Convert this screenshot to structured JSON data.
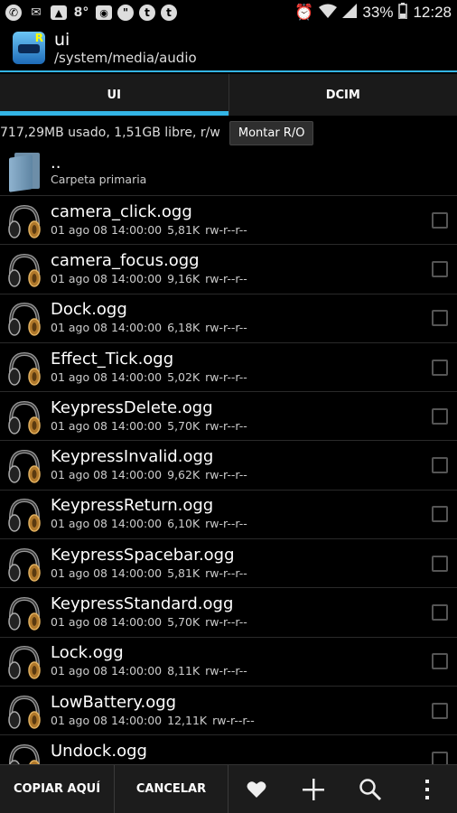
{
  "status_bar": {
    "left_icons": [
      "whatsapp-icon",
      "gmail-icon",
      "gallery-icon",
      "8°",
      "wifi-box-icon",
      "hangouts-icon",
      "tumblr-icon",
      "tumblr-icon"
    ],
    "battery": "33%",
    "time": "12:28"
  },
  "app": {
    "title": "ui",
    "path": "/system/media/audio"
  },
  "tabs": [
    {
      "label": "UI",
      "active": true
    },
    {
      "label": "DCIM",
      "active": false
    }
  ],
  "info": {
    "storage": "717,29MB usado, 1,51GB libre, r/w",
    "mount_label": "Montar R/O"
  },
  "parent": {
    "name": "..",
    "subtitle": "Carpeta primaria"
  },
  "files": [
    {
      "name": "camera_click.ogg",
      "date": "01 ago 08 14:00:00",
      "size": "5,81K",
      "perm": "rw-r--r--"
    },
    {
      "name": "camera_focus.ogg",
      "date": "01 ago 08 14:00:00",
      "size": "9,16K",
      "perm": "rw-r--r--"
    },
    {
      "name": "Dock.ogg",
      "date": "01 ago 08 14:00:00",
      "size": "6,18K",
      "perm": "rw-r--r--"
    },
    {
      "name": "Effect_Tick.ogg",
      "date": "01 ago 08 14:00:00",
      "size": "5,02K",
      "perm": "rw-r--r--"
    },
    {
      "name": "KeypressDelete.ogg",
      "date": "01 ago 08 14:00:00",
      "size": "5,70K",
      "perm": "rw-r--r--"
    },
    {
      "name": "KeypressInvalid.ogg",
      "date": "01 ago 08 14:00:00",
      "size": "9,62K",
      "perm": "rw-r--r--"
    },
    {
      "name": "KeypressReturn.ogg",
      "date": "01 ago 08 14:00:00",
      "size": "6,10K",
      "perm": "rw-r--r--"
    },
    {
      "name": "KeypressSpacebar.ogg",
      "date": "01 ago 08 14:00:00",
      "size": "5,81K",
      "perm": "rw-r--r--"
    },
    {
      "name": "KeypressStandard.ogg",
      "date": "01 ago 08 14:00:00",
      "size": "5,70K",
      "perm": "rw-r--r--"
    },
    {
      "name": "Lock.ogg",
      "date": "01 ago 08 14:00:00",
      "size": "8,11K",
      "perm": "rw-r--r--"
    },
    {
      "name": "LowBattery.ogg",
      "date": "01 ago 08 14:00:00",
      "size": "12,11K",
      "perm": "rw-r--r--"
    },
    {
      "name": "Undock.ogg",
      "date": "",
      "size": "",
      "perm": ""
    }
  ],
  "bottom_bar": {
    "copy_label": "COPIAR AQUÍ",
    "cancel_label": "CANCELAR",
    "icons": [
      "heart-icon",
      "plus-icon",
      "search-icon",
      "overflow-menu-icon"
    ]
  },
  "colors": {
    "accent": "#33b5e5",
    "background": "#000000"
  }
}
